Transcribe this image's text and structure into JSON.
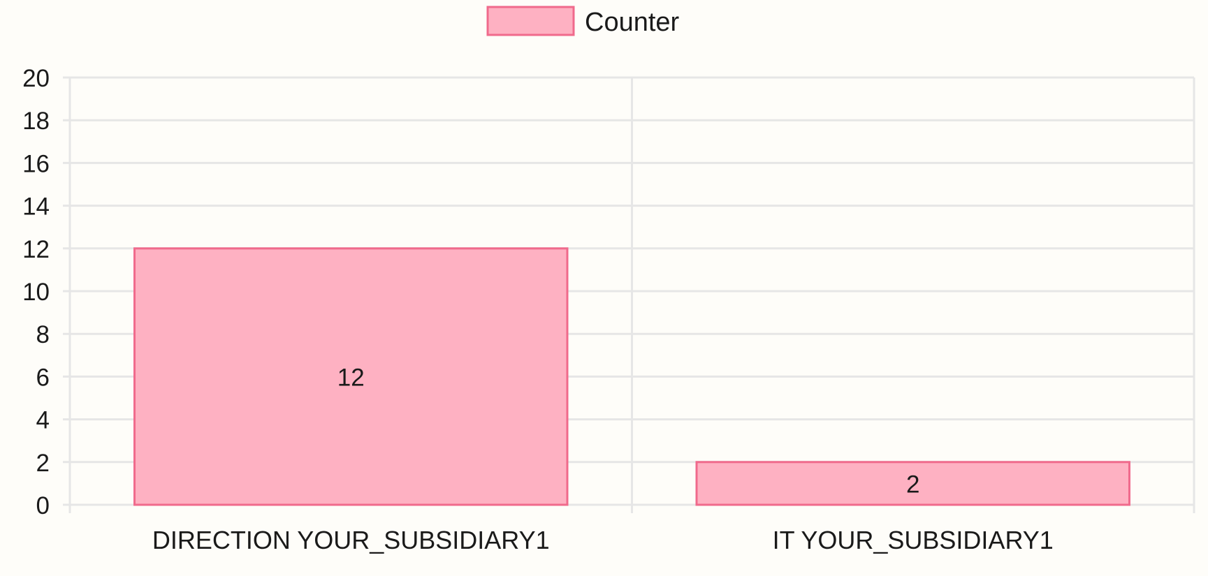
{
  "chart_data": {
    "type": "bar",
    "categories": [
      "DIRECTION YOUR_SUBSIDIARY1",
      "IT YOUR_SUBSIDIARY1"
    ],
    "series": [
      {
        "name": "Counter",
        "values": [
          12,
          2
        ],
        "fill_color": "#feb1c2",
        "border_color": "#f06a8c"
      }
    ],
    "ylim": [
      0,
      20
    ],
    "y_ticks": [
      0,
      2,
      4,
      6,
      8,
      10,
      12,
      14,
      16,
      18,
      20
    ],
    "data_labels": [
      "12",
      "2"
    ],
    "legend": {
      "position": "top-center",
      "label": "Counter"
    },
    "grid": true,
    "grid_color": "#e6e6e6",
    "background_color": "#fefdf9"
  }
}
